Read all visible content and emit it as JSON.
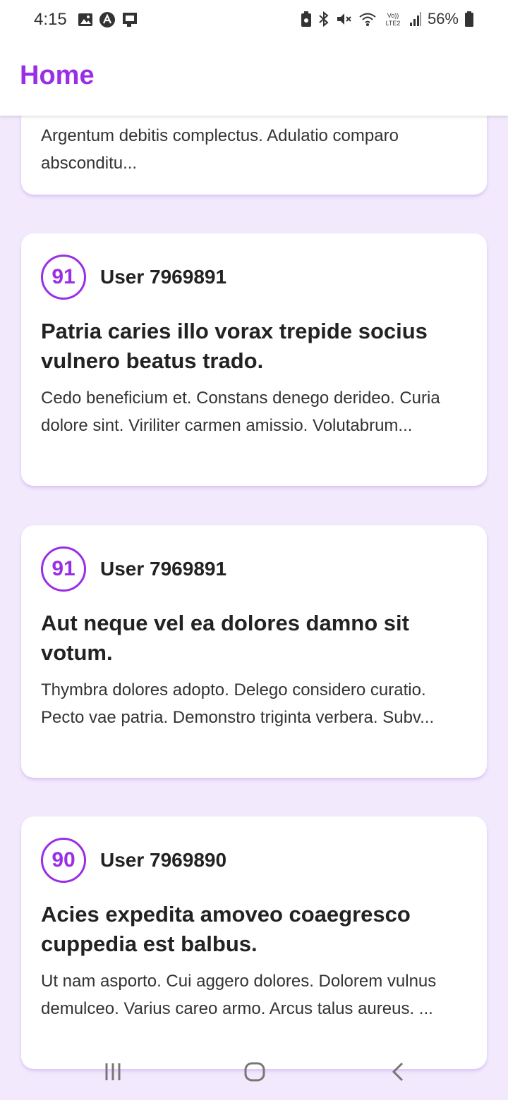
{
  "status_bar": {
    "time": "4:15",
    "battery": "56%"
  },
  "header": {
    "title": "Home"
  },
  "posts": [
    {
      "body": "Argentum debitis complectus. Adulatio comparo absconditu..."
    },
    {
      "score": "91",
      "user": "User 7969891",
      "title": "Patria caries illo vorax trepide socius vulnero beatus trado.",
      "body": "Cedo beneficium et. Constans denego derideo. Curia dolore sint. Viriliter carmen amissio. Volutabrum..."
    },
    {
      "score": "91",
      "user": "User 7969891",
      "title": "Aut neque vel ea dolores damno sit votum.",
      "body": "Thymbra dolores adopto. Delego considero curatio. Pecto vae patria. Demonstro triginta verbera. Subv..."
    },
    {
      "score": "90",
      "user": "User 7969890",
      "title": "Acies expedita amoveo coaegresco cuppedia est balbus.",
      "body": "Ut nam asporto. Cui aggero dolores. Dolorem vulnus demulceo. Varius careo armo. Arcus talus aureus. ..."
    }
  ],
  "theme": {
    "accent": "#9a2ee6",
    "background": "#f2e9fd",
    "card": "#ffffff"
  },
  "icons": {
    "status_left": [
      "gallery-icon",
      "app-icon",
      "cast-icon"
    ],
    "status_right": [
      "battery-saver-icon",
      "bluetooth-icon",
      "mute-icon",
      "wifi-icon",
      "volte-icon",
      "signal-icon",
      "battery-icon"
    ],
    "nav": [
      "recents-icon",
      "home-icon",
      "back-icon"
    ]
  }
}
